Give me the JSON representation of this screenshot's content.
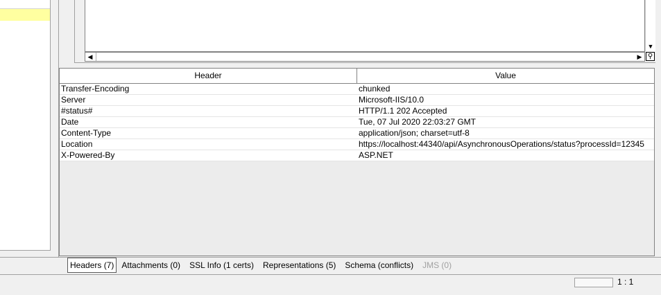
{
  "headers_table": {
    "columns": [
      "Header",
      "Value"
    ],
    "rows": [
      {
        "header": "Transfer-Encoding",
        "value": "chunked"
      },
      {
        "header": "Server",
        "value": "Microsoft-IIS/10.0"
      },
      {
        "header": "#status#",
        "value": "HTTP/1.1 202 Accepted"
      },
      {
        "header": "Date",
        "value": "Tue, 07 Jul 2020 22:03:27 GMT"
      },
      {
        "header": "Content-Type",
        "value": "application/json; charset=utf-8"
      },
      {
        "header": "Location",
        "value": "https://localhost:44340/api/AsynchronousOperations/status?processId=12345"
      },
      {
        "header": "X-Powered-By",
        "value": "ASP.NET"
      }
    ]
  },
  "tabs": [
    {
      "label": "Headers (7)",
      "active": true
    },
    {
      "label": "Attachments (0)"
    },
    {
      "label": "SSL Info (1 certs)"
    },
    {
      "label": "Representations (5)"
    },
    {
      "label": "Schema (conflicts)"
    },
    {
      "label": "JMS (0)",
      "disabled": true
    }
  ],
  "status_bar": {
    "position": "1 : 1"
  },
  "icons": {
    "scroll_up": "arrow-down-icon",
    "scroll_left": "arrow-left-icon",
    "scroll_right": "arrow-right-icon",
    "zoom": "magnifier-icon"
  }
}
